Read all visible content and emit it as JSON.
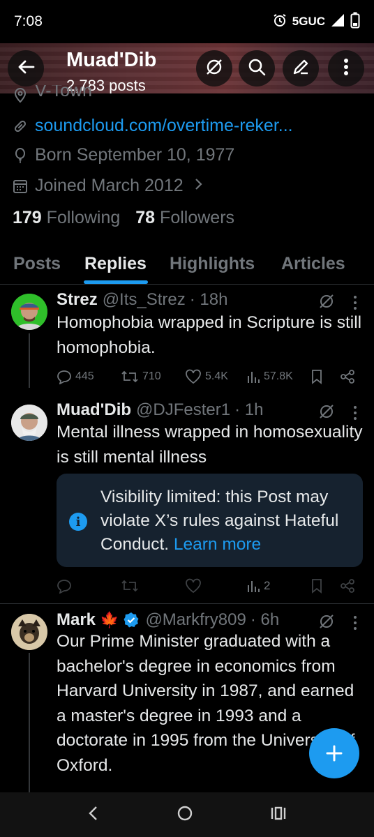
{
  "status": {
    "time": "7:08",
    "network": "5GUC"
  },
  "header": {
    "title": "Muad'Dib",
    "posts": "2,783 posts"
  },
  "profile": {
    "location": "V-Town",
    "website": "soundcloud.com/overtime-reker...",
    "born": "Born September 10, 1977",
    "joined": "Joined March 2012",
    "following_count": "179",
    "following_label": "Following",
    "followers_count": "78",
    "followers_label": "Followers"
  },
  "tabs": [
    "Posts",
    "Replies",
    "Highlights",
    "Articles"
  ],
  "active_tab": "Replies",
  "tweets": [
    {
      "name": "Strez",
      "handle": "@Its_Strez",
      "time": "· 18h",
      "text": "Homophobia wrapped in Scripture is still homophobia.",
      "replies": "445",
      "retweets": "710",
      "likes": "5.4K",
      "views": "57.8K"
    },
    {
      "name": "Muad'Dib",
      "handle": "@DJFester1",
      "time": "· 1h",
      "text": "Mental illness wrapped in homosexuality is still mental illness",
      "notice_text": "Visibility limited: this Post may violate X’s rules against Hateful Conduct.",
      "notice_link": "Learn more",
      "views": "2"
    },
    {
      "name": "Mark",
      "name_emoji": "🍁",
      "handle": "@Markfry809",
      "time": "· 6h",
      "text": "Our Prime Minister graduated with a bachelor's degree in economics from Harvard University in 1987, and earned a master's degree in 1993 and a doctorate in 1995 from the University of Oxford."
    }
  ],
  "colors": {
    "accent": "#1d9bf0",
    "muted": "#71767b",
    "text": "#e7e9ea",
    "background": "#000000"
  }
}
